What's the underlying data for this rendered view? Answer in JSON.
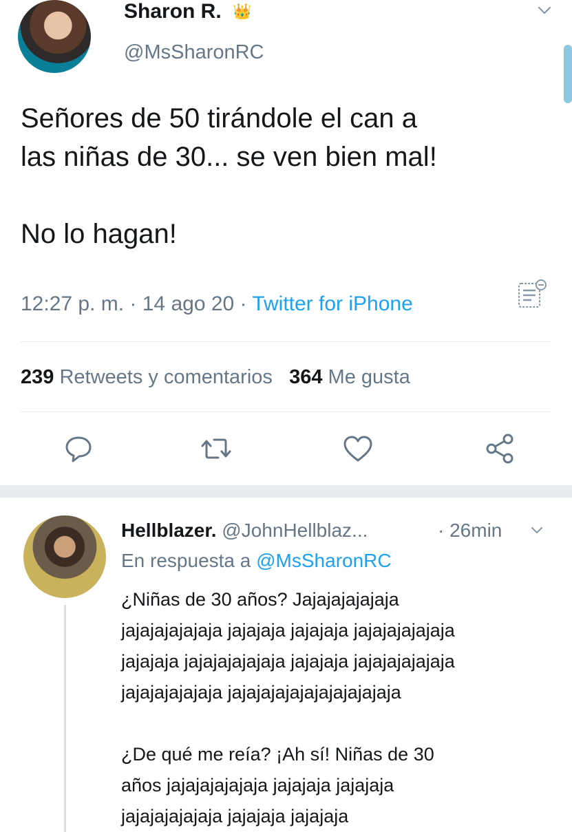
{
  "tweet": {
    "author_name": "Sharon R.",
    "crown_emoji": "👑",
    "handle": "@MsSharonRC",
    "text_line1": "Señores de 50 tirándole el can a",
    "text_line2": "las niñas de 30... se ven bien mal!",
    "text_line3": "No lo hagan!",
    "time": "12:27 p. m. · 14 ago 20 · ",
    "source": "Twitter for iPhone",
    "retweets_count": "239",
    "retweets_label": "Retweets y comentarios",
    "likes_count": "364",
    "likes_label": "Me gusta"
  },
  "reply": {
    "author_name": "Hellblazer.",
    "handle": "@JohnHellblaz...",
    "time": "· 26min",
    "in_reply_prefix": "En respuesta a ",
    "in_reply_handle": "@MsSharonRC",
    "lines": [
      "¿Niñas de 30 años? Jajajajajajaja",
      "jajajajajajaja jajajaja jajajaja jajajajajajaja",
      "jajajaja jajajajajajaja jajajaja jajajajajajaja",
      "jajajajajajaja jajajajajajajajajajajaja",
      "¿De qué me reía? ¡Ah sí! Niñas de 30",
      "años jajajajajajaja jajajaja jajajaja",
      "jajajajajajaja jajajaja jajajaja"
    ]
  },
  "colors": {
    "link_blue": "#1da1f2",
    "muted_gray": "#657786",
    "text_dark": "#14171a",
    "divider": "#e6ecf0"
  },
  "icons": [
    "chevron-down-icon",
    "list-icon",
    "reply-icon",
    "retweet-icon",
    "like-icon",
    "share-icon"
  ]
}
